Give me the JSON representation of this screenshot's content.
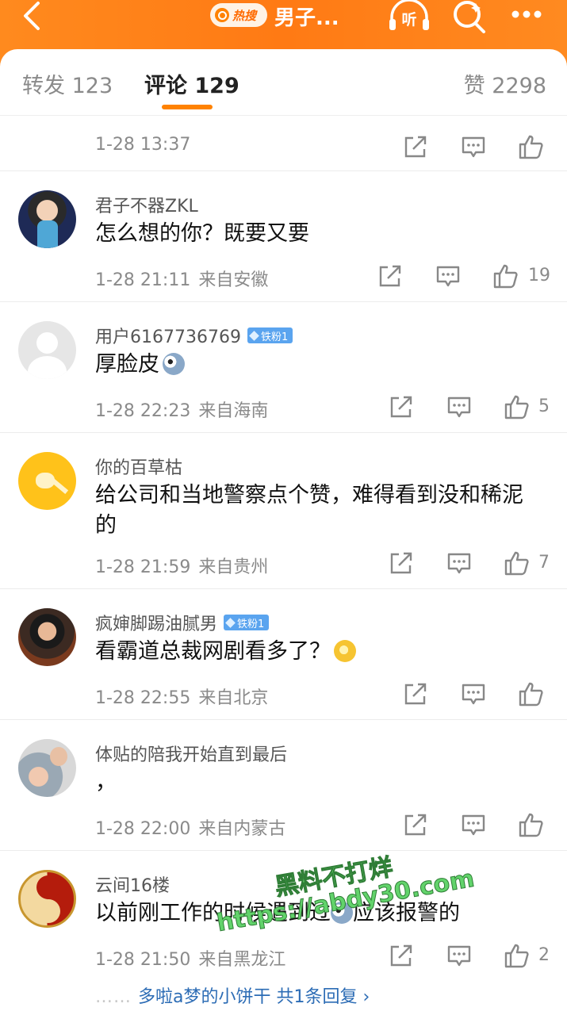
{
  "header": {
    "hot_label": "热搜",
    "topic": "男子...",
    "listen_label": "听"
  },
  "tabs": {
    "repost": "转发 123",
    "comments": "评论 129",
    "likes": "赞 2298"
  },
  "comments": [
    {
      "time": "1-28 13:37",
      "location": "",
      "likes": ""
    },
    {
      "user": "君子不器ZKL",
      "text": "怎么想的你？既要又要",
      "time": "1-28 21:11",
      "location": "来自安徽",
      "likes": "19"
    },
    {
      "user": "用户6167736769",
      "badge": "铁粉1",
      "text": "厚脸皮",
      "time": "1-28 22:23",
      "location": "来自海南",
      "likes": "5"
    },
    {
      "user": "你的百草枯",
      "text": "给公司和当地警察点个赞，难得看到没和稀泥的",
      "time": "1-28 21:59",
      "location": "来自贵州",
      "likes": "7"
    },
    {
      "user": "疯婶脚踢油腻男",
      "badge": "铁粉1",
      "text": "看霸道总裁网剧看多了？",
      "time": "1-28 22:55",
      "location": "来自北京",
      "likes": ""
    },
    {
      "user": "体贴的陪我开始直到最后",
      "text": "，",
      "time": "1-28 22:00",
      "location": "来自内蒙古",
      "likes": ""
    },
    {
      "user": "云间16楼",
      "text": "以前刚工作的时候遇到过",
      "text_tail": "应该报警的",
      "time": "1-28 21:50",
      "location": "来自黑龙江",
      "likes": "2"
    }
  ],
  "reply_link": {
    "dots": "……",
    "text": "多啦a梦的小饼干 共1条回复 ›"
  },
  "watermark": {
    "line1": "黑料不打烊",
    "line2": "https://abdy30.com"
  },
  "colors": {
    "accent": "#ff8200",
    "link": "#2c6cb5",
    "badge": "#5aa4ef"
  }
}
